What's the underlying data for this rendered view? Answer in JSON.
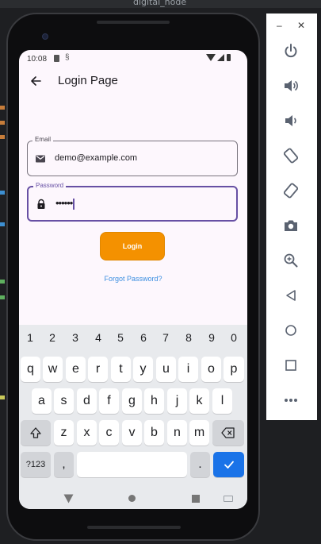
{
  "ide": {
    "title": "digital_node"
  },
  "status_bar": {
    "time": "10:08"
  },
  "app_bar": {
    "title": "Login Page"
  },
  "form": {
    "email": {
      "label": "Email",
      "value": "demo@example.com"
    },
    "password": {
      "label": "Password",
      "value": "••••••"
    },
    "login_label": "Login",
    "forgot_label": "Forgot Password?"
  },
  "keyboard": {
    "numbers": [
      "1",
      "2",
      "3",
      "4",
      "5",
      "6",
      "7",
      "8",
      "9",
      "0"
    ],
    "row1": [
      "q",
      "w",
      "e",
      "r",
      "t",
      "y",
      "u",
      "i",
      "o",
      "p"
    ],
    "row2": [
      "a",
      "s",
      "d",
      "f",
      "g",
      "h",
      "j",
      "k",
      "l"
    ],
    "row3": [
      "z",
      "x",
      "c",
      "v",
      "b",
      "n",
      "m"
    ],
    "symbols_label": "?123",
    "comma_label": ",",
    "period_label": "."
  },
  "emulator_panel": {
    "minimize_label": "–",
    "close_label": "✕",
    "buttons": [
      "power-icon",
      "volume-up-icon",
      "volume-down-icon",
      "rotate-left-icon",
      "rotate-right-icon",
      "camera-icon",
      "zoom-icon",
      "back-icon",
      "home-icon",
      "overview-icon",
      "more-icon"
    ]
  },
  "colors": {
    "accent": "#6750a4",
    "login_button": "#f49100",
    "link": "#3a8ee0",
    "enter_key": "#1a73e8"
  }
}
